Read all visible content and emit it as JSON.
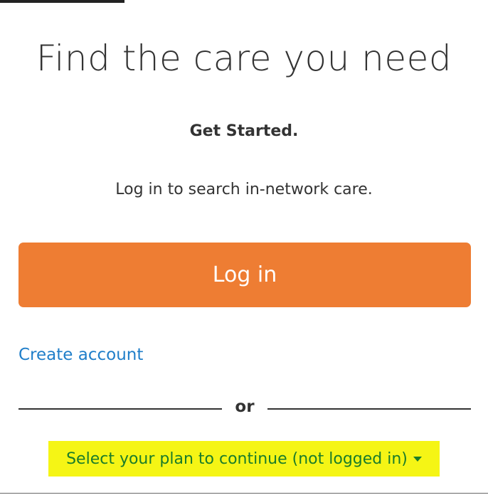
{
  "page": {
    "title": "Find the care you need",
    "subtitle": "Get Started.",
    "description": "Log in to search in-network care."
  },
  "actions": {
    "login_label": "Log in",
    "create_account_label": "Create account",
    "divider_text": "or",
    "plan_select_label": "Select your plan to continue (not logged in)",
    "plan_select_icon": "caret-down-icon"
  },
  "colors": {
    "primary_button": "#ee7d33",
    "link": "#1f7ec9",
    "highlight": "#f5f515",
    "plan_text": "#1a7c2a",
    "body_text": "#333333"
  }
}
